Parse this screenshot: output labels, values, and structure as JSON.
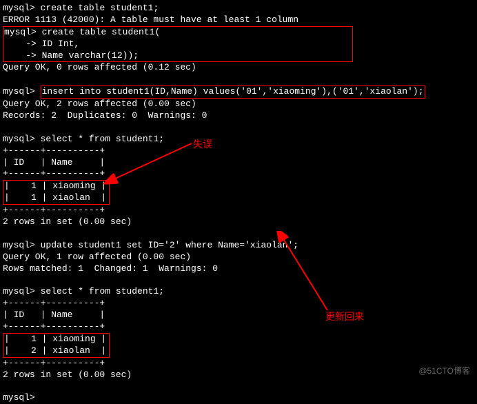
{
  "prompt": "mysql>",
  "cont": "    ->",
  "cmds": {
    "create_fail": "create table student1;",
    "create_ok_l1": "create table student1(",
    "create_ok_l2": "ID Int,",
    "create_ok_l3": "Name varchar(12));",
    "insert": "insert into student1(ID,Name) values('01','xiaoming'),('01','xiaolan');",
    "select": "select * from student1;",
    "update": "update student1 set ID='2' where Name='xiaolan';"
  },
  "msgs": {
    "err_1113": "ERROR 1113 (42000): A table must have at least 1 column",
    "ok_012": "Query OK, 0 rows affected (0.12 sec)",
    "ok_2_000": "Query OK, 2 rows affected (0.00 sec)",
    "records": "Records: 2  Duplicates: 0  Warnings: 0",
    "rows2": "2 rows in set (0.00 sec)",
    "ok_1_000": "Query OK, 1 row affected (0.00 sec)",
    "matched": "Rows matched: 1  Changed: 1  Warnings: 0"
  },
  "table": {
    "sep": "+------+----------+",
    "hdr": "| ID   | Name     |",
    "r1_1": "|    1 | xiaoming |",
    "r1_2": "|    1 | xiaolan  |",
    "r2_1": "|    1 | xiaoming |",
    "r2_2": "|    2 | xiaolan  |"
  },
  "annotations": {
    "mistake": "失误",
    "updated": "更新回来"
  },
  "watermark": "@51CTO博客"
}
